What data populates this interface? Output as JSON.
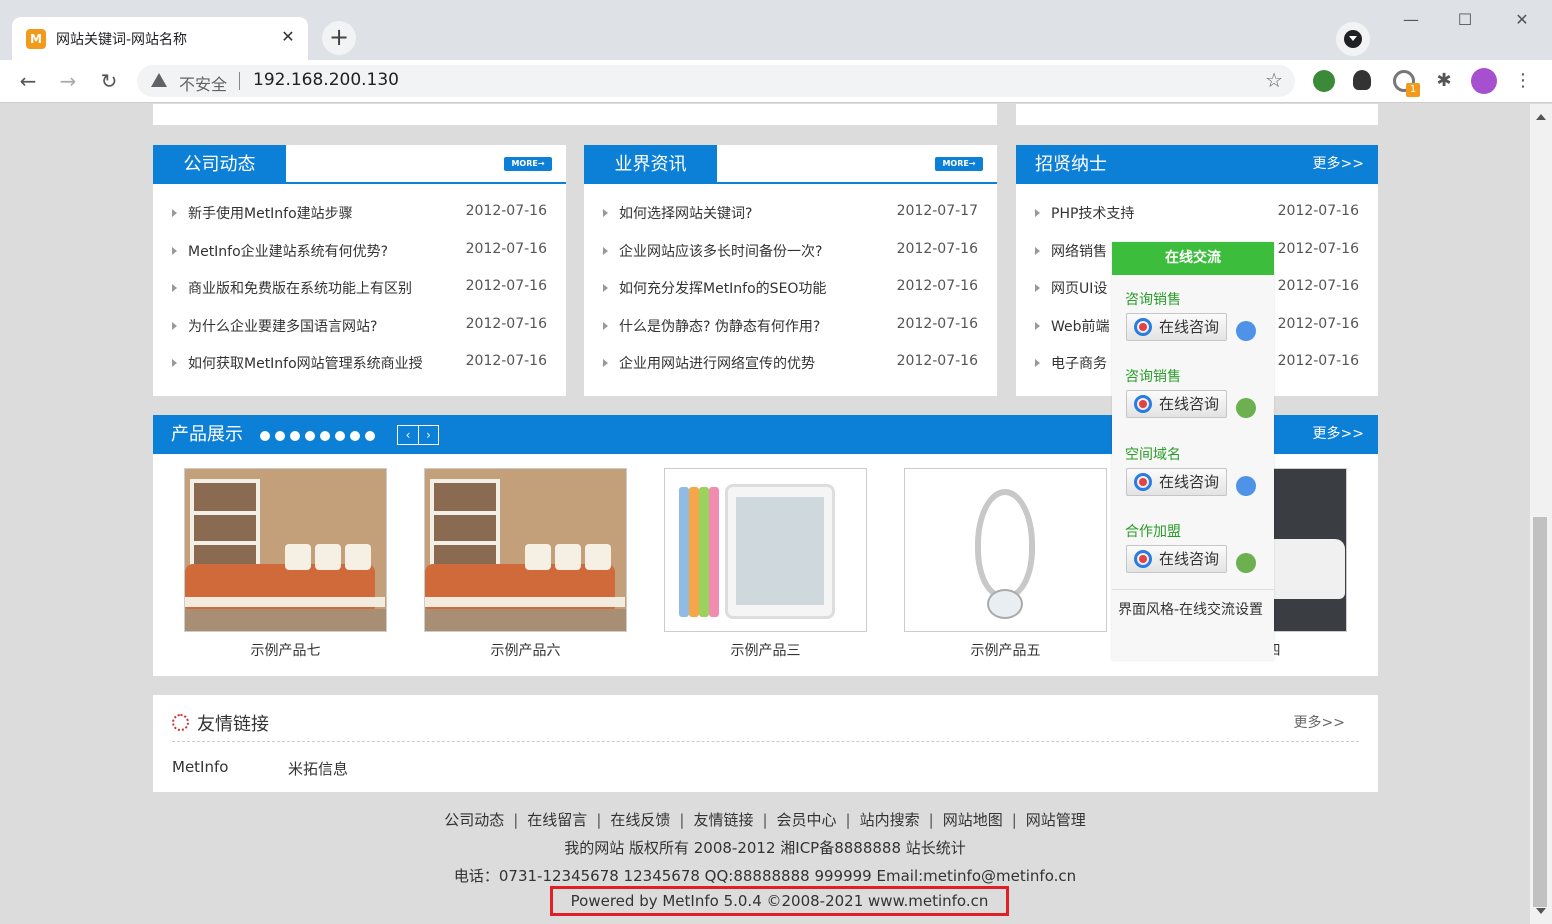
{
  "browser": {
    "tab_title": "网站关键词-网站名称",
    "favicon_letter": "M",
    "insecure_label": "不安全",
    "url": "192.168.200.130",
    "ext_badge": "1"
  },
  "panels": [
    {
      "title": "公司动态",
      "more": "MORE→",
      "items": [
        {
          "title": "新手使用MetInfo建站步骤",
          "date": "2012-07-16"
        },
        {
          "title": "MetInfo企业建站系统有何优势?",
          "date": "2012-07-16"
        },
        {
          "title": "商业版和免费版在系统功能上有区别",
          "date": "2012-07-16"
        },
        {
          "title": "为什么企业要建多国语言网站?",
          "date": "2012-07-16"
        },
        {
          "title": "如何获取MetInfo网站管理系统商业授",
          "date": "2012-07-16"
        }
      ]
    },
    {
      "title": "业界资讯",
      "more": "MORE→",
      "items": [
        {
          "title": "如何选择网站关键词?",
          "date": "2012-07-17"
        },
        {
          "title": "企业网站应该多长时间备份一次?",
          "date": "2012-07-16"
        },
        {
          "title": "如何充分发挥MetInfo的SEO功能",
          "date": "2012-07-16"
        },
        {
          "title": "什么是伪静态? 伪静态有何作用?",
          "date": "2012-07-16"
        },
        {
          "title": "企业用网站进行网络宣传的优势",
          "date": "2012-07-16"
        }
      ]
    },
    {
      "title": "招贤纳士",
      "more": "更多>>",
      "items": [
        {
          "title": "PHP技术支持",
          "date": "2012-07-16"
        },
        {
          "title": "网络销售",
          "date": "2012-07-16"
        },
        {
          "title": "网页UI设",
          "date": "2012-07-16"
        },
        {
          "title": "Web前端",
          "date": "2012-07-16"
        },
        {
          "title": "电子商务",
          "date": "2012-07-16"
        }
      ]
    }
  ],
  "products": {
    "title": "产品展示",
    "more": "更多>>",
    "prev": "‹",
    "next": "›",
    "items": [
      {
        "name": "示例产品七"
      },
      {
        "name": "示例产品六"
      },
      {
        "name": "示例产品三"
      },
      {
        "name": "示例产品五"
      },
      {
        "name": "示例产品四"
      }
    ]
  },
  "links": {
    "title": "友情链接",
    "more": "更多>>",
    "items": [
      "MetInfo",
      "米拓信息"
    ]
  },
  "chat": {
    "title": "在线交流",
    "button_label": "在线咨询",
    "groups": [
      "咨询销售",
      "咨询销售",
      "空间域名",
      "合作加盟"
    ],
    "footer": "界面风格-在线交流设置"
  },
  "footer": {
    "nav": [
      "公司动态",
      "在线留言",
      "在线反馈",
      "友情链接",
      "会员中心",
      "站内搜索",
      "网站地图",
      "网站管理"
    ],
    "copyright": "我的网站 版权所有 2008-2012 湘ICP备8888888 站长统计",
    "contact": "电话：0731-12345678 12345678 QQ:88888888 999999 Email:metinfo@metinfo.cn",
    "powered": "Powered by MetInfo 5.0.4 ©2008-2021  www.metinfo.cn"
  },
  "colors": {
    "accent_blue": "#0c7fd6",
    "chat_green": "#3cbd3c",
    "highlight_red": "#e01f26"
  }
}
